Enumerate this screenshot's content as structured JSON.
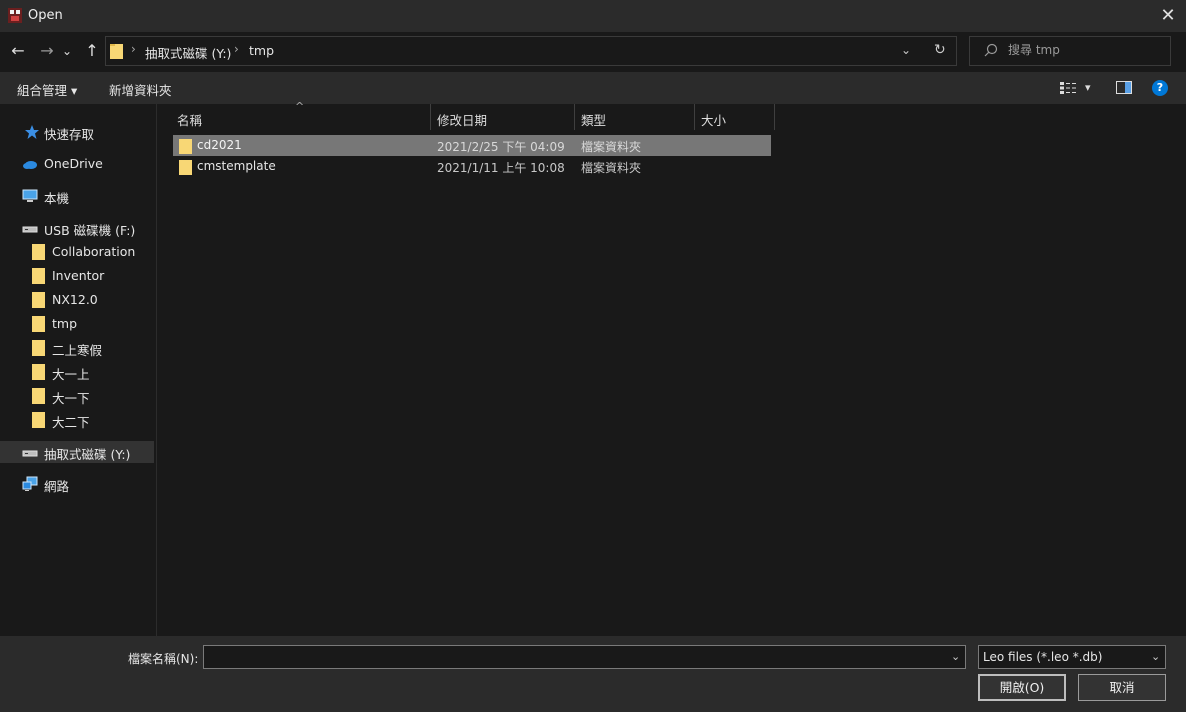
{
  "window": {
    "title": "Open",
    "close_glyph": "✕"
  },
  "nav": {
    "back_glyph": "←",
    "forward_glyph": "→",
    "recent_glyph": "⌄",
    "up_glyph": "↑",
    "breadcrumbs": [
      "抽取式磁碟 (Y:)",
      "tmp"
    ],
    "separator": "›",
    "dropdown_glyph": "⌄",
    "refresh_glyph": "↻",
    "search_placeholder": "搜尋 tmp"
  },
  "toolbar": {
    "organize_label": "組合管理 ▾",
    "new_folder_label": "新增資料夾",
    "view_dropdown_glyph": "▾",
    "help_glyph": "?"
  },
  "sidebar": {
    "items": [
      {
        "label": "快速存取",
        "icon": "star-icon"
      },
      {
        "label": "OneDrive",
        "icon": "cloud-icon"
      },
      {
        "label": "本機",
        "icon": "computer-icon"
      },
      {
        "label": "USB 磁碟機 (F:)",
        "icon": "drive-icon"
      },
      {
        "label": "Collaboration",
        "icon": "folder-icon"
      },
      {
        "label": "Inventor",
        "icon": "folder-icon"
      },
      {
        "label": "NX12.0",
        "icon": "folder-icon"
      },
      {
        "label": "tmp",
        "icon": "folder-icon"
      },
      {
        "label": "二上寒假",
        "icon": "folder-icon"
      },
      {
        "label": "大一上",
        "icon": "folder-icon"
      },
      {
        "label": "大一下",
        "icon": "folder-icon"
      },
      {
        "label": "大二下",
        "icon": "folder-icon"
      },
      {
        "label": "抽取式磁碟 (Y:)",
        "icon": "drive-icon"
      },
      {
        "label": "網路",
        "icon": "network-icon"
      }
    ]
  },
  "files": {
    "columns": [
      "名稱",
      "修改日期",
      "類型",
      "大小"
    ],
    "sort_glyph": "^",
    "rows": [
      {
        "name": "cd2021",
        "modified": "2021/2/25 下午 04:09",
        "type": "檔案資料夾",
        "size": ""
      },
      {
        "name": "cmstemplate",
        "modified": "2021/1/11 上午 10:08",
        "type": "檔案資料夾",
        "size": ""
      }
    ]
  },
  "footer": {
    "filename_label": "檔案名稱(N):",
    "filename_value": "",
    "filename_dropdown_glyph": "⌄",
    "filter_value": "Leo files (*.leo *.db)",
    "filter_dropdown_glyph": "⌄",
    "open_label": "開啟(O)",
    "cancel_label": "取消"
  },
  "colors": {
    "folder": "#f8d775",
    "accent": "#0078d7",
    "selection": "#777777"
  }
}
